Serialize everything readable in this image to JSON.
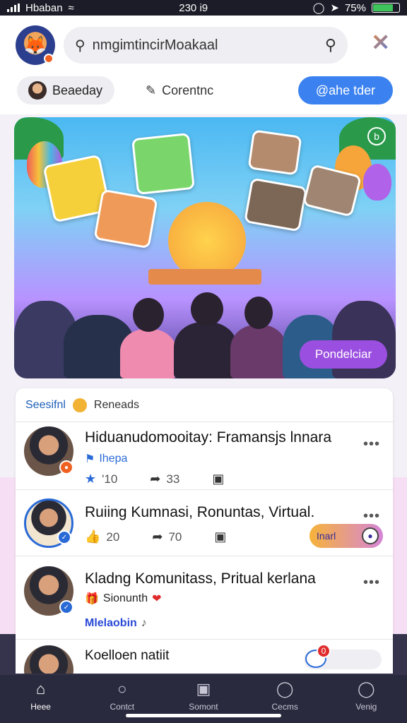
{
  "status_bar": {
    "carrier": "Hbaban",
    "time": "230 i9",
    "battery": "75%"
  },
  "header": {
    "search_text": "nmgimtincirMoakaal",
    "chips": [
      "Beaeday",
      "Corentnc",
      "@ahe tder"
    ]
  },
  "hero": {
    "button_label": "Pondelciar"
  },
  "feed": {
    "header_left": "Seesifnl",
    "header_right": "Reneads",
    "posts": [
      {
        "title": "Hiduanudomooitay: Framansjs lnnara",
        "subtitle": "Ihepa",
        "likes": "'10",
        "shares": "33"
      },
      {
        "title": "Ruiing Kumnasi, Ronuntas, Virtual.",
        "likes": "20",
        "shares": "70",
        "pill_label": "Inarl"
      },
      {
        "title": "Kladng Komunitass, Pritual kerlana",
        "subtitle": "Sionunth",
        "tag": "Mlelaobin"
      },
      {
        "title": "Koelloen natiit",
        "comment_count": "0"
      }
    ]
  },
  "bottom_nav": [
    "Heee",
    "Contct",
    "Somont",
    "Cecms",
    "Venig"
  ],
  "colors": {
    "accent_blue": "#3b82f0",
    "accent_purple": "#9b4fe0",
    "nav_bg": "#2a2a3e"
  }
}
